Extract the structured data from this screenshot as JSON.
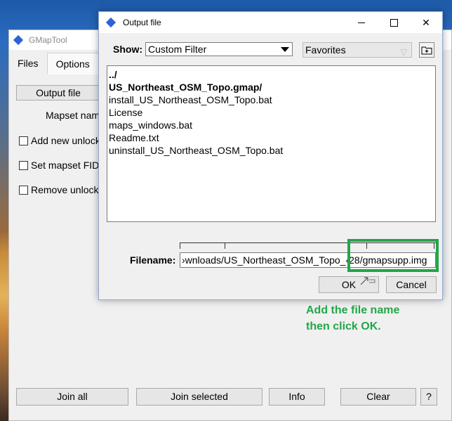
{
  "main_window": {
    "title": "GMapTool",
    "menu": [
      "Files",
      "Options"
    ],
    "output_file_button": "Output file",
    "mapset_name_label": "Mapset nam",
    "checkboxes": [
      "Add new unlock",
      "Set mapset FID",
      "Remove unlock"
    ],
    "bottom_buttons": {
      "join_all": "Join all",
      "join_selected": "Join selected",
      "info": "Info",
      "clear": "Clear",
      "help": "?"
    }
  },
  "dialog": {
    "title": "Output file",
    "show_label": "Show:",
    "filter_value": "Custom Filter",
    "favorites_label": "Favorites",
    "files": [
      "../",
      "US_Northeast_OSM_Topo.gmap/",
      "install_US_Northeast_OSM_Topo.bat",
      "License",
      "maps_windows.bat",
      "Readme.txt",
      "uninstall_US_Northeast_OSM_Topo.bat"
    ],
    "filename_label": "Filename:",
    "filename_value": "›wnloads/US_Northeast_OSM_Topo_‹28/gmapsupp.img",
    "ok_button": "OK",
    "cancel_button": "Cancel"
  },
  "annotation": {
    "note": "Add the file name then click OK.",
    "color": "#22a64a"
  },
  "colors": {
    "window_bg": "#f0f0f0",
    "title_icon": "#2f62d6"
  }
}
